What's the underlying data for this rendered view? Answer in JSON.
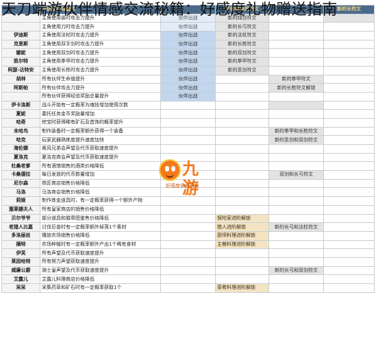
{
  "title": "天刀端游伙伴情感交流秘籍：好感度礼物赠送指南",
  "header": {
    "effect": "降低道具理速度",
    "col3": "新的温泉的符文",
    "col5": "新的长符文"
  },
  "rows": [
    {
      "name": "",
      "effect": "主角使用装时攻击力提升",
      "c3": "伙伴出战",
      "c4": "新的绿剑符文",
      "c5": ""
    },
    {
      "name": "",
      "effect": "主角使用刀时攻击力提升",
      "c3": "伙伴出战",
      "c4": "新的长弓符文",
      "c5": ""
    },
    {
      "name": "伊迪斯",
      "effect": "主角使用法杖时攻击力提升",
      "c3": "伙伴出战",
      "c4": "新的法杖符文",
      "c5": ""
    },
    {
      "name": "克里斯",
      "effect": "主角使用双手剑时攻击力提升",
      "c3": "伙伴出战",
      "c4": "新的长枪符文",
      "c5": ""
    },
    {
      "name": "娜妮",
      "effect": "主角使用双剑时攻击力提升",
      "c3": "伙伴出战",
      "c4": "新的双剑符文",
      "c5": ""
    },
    {
      "name": "凯尔特",
      "effect": "主角使用拳甲时攻击力提升",
      "c3": "伙伴出战",
      "c4": "新的拳甲符文",
      "c5": ""
    },
    {
      "name": "阿瑟-达特安",
      "effect": "主角使用长枪时攻击力提升",
      "c3": "伙伴出战",
      "c4": "新的圣剑符文",
      "c5": ""
    },
    {
      "name": "胡林",
      "effect": "所有伙伴生命值提升",
      "c3": "伙伴出战",
      "c4": "",
      "c5": "新的拳甲符文"
    },
    {
      "name": "阿斯帕",
      "effect": "所有伙伴攻击力提升",
      "c3": "伙伴出战",
      "c4": "",
      "c5": "新的长枪符文解锁"
    },
    {
      "name": "",
      "effect": "所有伙伴获得经验奖励总量提升",
      "c3": "伙伴出战",
      "c4": "",
      "c5": ""
    },
    {
      "name": "伊卡洛斯",
      "effect": "战斗开始有一定概率为魂技增加使用次数",
      "c3": "",
      "c4": "",
      "c5": ""
    },
    {
      "name": "夏妮",
      "effect": "委托任务金币奖励量增加",
      "c3": "",
      "c4": "",
      "c5": ""
    },
    {
      "name": "哈奇",
      "effect": "挖宝时获得稀有矿石及首饰的概率提升",
      "c3": "",
      "c4": "",
      "c5": ""
    },
    {
      "name": "末哈鸟",
      "effect": "制作装备时一定概率额外获得一个装备",
      "c3": "",
      "c4": "",
      "c5": "新的拳甲和长枪符文"
    },
    {
      "name": "哈克",
      "effect": "玩家武器熟练度提升速度加快",
      "c3": "",
      "c4": "",
      "c5": "新的圣剑和双剑符文"
    },
    {
      "name": "海伦娜",
      "effect": "奥风兄弟会声望及代币获取速度提升",
      "c3": "",
      "c4": "",
      "c5": ""
    },
    {
      "name": "夏洛克",
      "effect": "夏洛克商会声望及代币获取速度提升",
      "c3": "",
      "c4": "",
      "c5": ""
    },
    {
      "name": "杜桑老爹",
      "effect": "所有酒馆销售的酒类价格降低",
      "c3": "",
      "c4": "",
      "c5": ""
    },
    {
      "name": "卡桑德拉",
      "effect": "每日发放的代币数量增加",
      "c3": "",
      "c4": "",
      "c5": "双剑和长弓符文"
    },
    {
      "name": "尼尔森",
      "effect": "铁匠商店销售价格降低",
      "c3": "",
      "c4": "",
      "c5": ""
    },
    {
      "name": "马洛",
      "effect": "马洛商会销售价格降低",
      "c3": "",
      "c4": "",
      "c5": ""
    },
    {
      "name": "莉娅",
      "effect": "制作炼金道具时，有一定概率获得一个额外产物",
      "c3": "",
      "c4": "",
      "c5": ""
    },
    {
      "name": "塞莱娜夫人",
      "effect": "所有皇家商店的销售价格降低",
      "c3": "",
      "c4": "",
      "c5": ""
    },
    {
      "name": "贝尔爷爷",
      "effect": "部分道具和徽章图鉴售价格降低",
      "c3": "",
      "c4": "探险家进阶解锁",
      "c5": ""
    },
    {
      "name": "老猎人比嘉",
      "effect": "讨伐巨兽时有一定概率额外掉落1个素材",
      "c3": "",
      "c4": "猎人进阶解锁",
      "c5": "新的长弓和法杖符文"
    },
    {
      "name": "多洛丽丝",
      "effect": "播放农场销售价格降低",
      "c3": "",
      "c4": "厨师料理进阶解锁",
      "c5": ""
    },
    {
      "name": "摘特",
      "effect": "农场种植时有一定概率额外产出1个稀有食材",
      "c3": "",
      "c4": "主餐料理进阶解锁",
      "c5": ""
    },
    {
      "name": "伊芙",
      "effect": "所有声望及代币获取速度提升",
      "c3": "",
      "c4": "",
      "c5": ""
    },
    {
      "name": "莱因哈特",
      "effect": "所有努力声望获取速度提升",
      "c3": "",
      "c4": "",
      "c5": ""
    },
    {
      "name": "威廉公爵",
      "effect": "骑士皇声望及代币获取速度提升",
      "c3": "",
      "c4": "",
      "c5": "新的长弓和双剑符文"
    },
    {
      "name": "艾露儿",
      "effect": "艾露儿料理商店价格降低",
      "c3": "",
      "c4": "",
      "c5": ""
    },
    {
      "name": "采采",
      "effect": "采集药草和矿石时有一定概率获取1个",
      "c3": "",
      "c4": "菜肴料理进阶解锁",
      "c5": ""
    }
  ],
  "logo": {
    "brand": "九游",
    "sub": "好感度调查报告"
  }
}
